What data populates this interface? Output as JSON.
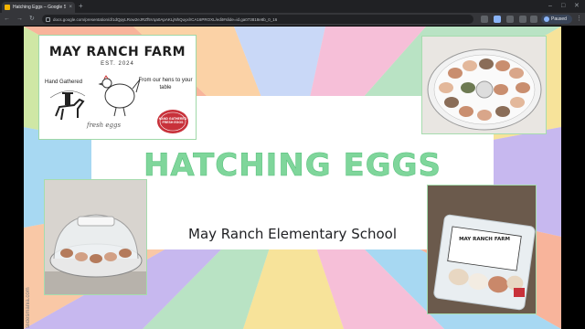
{
  "browser": {
    "tab_title": "Hatching Eggs – Google Slid",
    "tab_close": "×",
    "new_tab": "+",
    "url": "docs.google.com/presentation/d/1dQpyLRow2eJRZf5Vqa0ApAKLjNhQuyxlrCA16PROXL/edit#slide=id.ga073818e8b_0_16",
    "profile_label": "Paused",
    "minimize": "–",
    "maximize": "□",
    "close": "✕",
    "back": "←",
    "forward": "→",
    "reload": "↻",
    "menu": "⋮",
    "colors": {
      "tabbar": "#202124",
      "toolbar": "#35363a",
      "omnibox": "#202124"
    }
  },
  "slide": {
    "title": "HATCHING EGGS",
    "subtitle": "May Ranch Elementary School",
    "side_credit": "slidesmania.com",
    "colors": {
      "title": "#7fd69b",
      "frame": "#a6dcae"
    },
    "logo": {
      "title": "MAY RANCH FARM",
      "established": "EST. 2024",
      "left_tagline": "Hand Gathered",
      "right_tagline": "From our hens to your table",
      "script_text": "fresh eggs",
      "seal_text": "HAND GATHERED FRESH EGGS"
    },
    "photos": {
      "eggs_incubator": "eggs-in-incubator",
      "incubator": "incubator-dome",
      "carton": "egg-carton",
      "carton_label": "MAY RANCH FARM"
    }
  }
}
